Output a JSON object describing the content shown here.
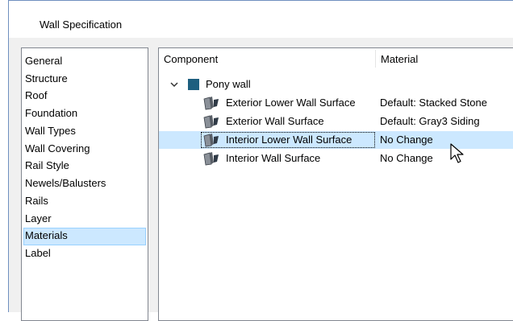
{
  "window": {
    "title": "Wall Specification"
  },
  "nav": {
    "items": [
      {
        "label": "General",
        "key": "general"
      },
      {
        "label": "Structure",
        "key": "structure"
      },
      {
        "label": "Roof",
        "key": "roof"
      },
      {
        "label": "Foundation",
        "key": "foundation"
      },
      {
        "label": "Wall Types",
        "key": "wall-types"
      },
      {
        "label": "Wall Covering",
        "key": "wall-covering"
      },
      {
        "label": "Rail Style",
        "key": "rail-style"
      },
      {
        "label": "Newels/Balusters",
        "key": "newels-balusters"
      },
      {
        "label": "Rails",
        "key": "rails"
      },
      {
        "label": "Layer",
        "key": "layer"
      },
      {
        "label": "Materials",
        "key": "materials"
      },
      {
        "label": "Label",
        "key": "label"
      }
    ],
    "selected": "Materials"
  },
  "table": {
    "col_component": "Component",
    "col_material": "Material",
    "root": {
      "label": "Pony wall",
      "icon": "wall-object-icon",
      "color": "#1d5f7f",
      "expanded": true
    },
    "rows": [
      {
        "component": "Exterior Lower Wall Surface",
        "material": "Default: Stacked Stone",
        "icon": "material-surface-icon"
      },
      {
        "component": "Exterior Wall Surface",
        "material": "Default: Gray3 Siding",
        "icon": "material-surface-icon"
      },
      {
        "component": "Interior Lower Wall Surface",
        "material": "No Change",
        "icon": "material-surface-icon"
      },
      {
        "component": "Interior Wall Surface",
        "material": "No Change",
        "icon": "material-surface-icon"
      }
    ],
    "selected_row": "Interior Lower Wall Surface"
  },
  "colors": {
    "selection": "#cce8ff",
    "selection_border": "#99d1ff",
    "window_border": "#6f8fbf"
  }
}
